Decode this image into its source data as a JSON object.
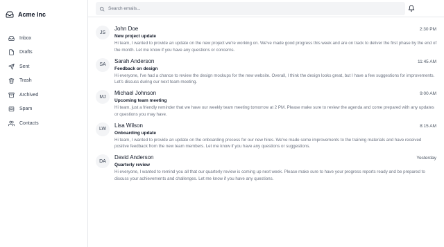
{
  "brand": {
    "name": "Acme Inc",
    "icon": "inbox-tray-icon"
  },
  "sidebar": {
    "items": [
      {
        "label": "Inbox",
        "icon": "inbox-icon"
      },
      {
        "label": "Drafts",
        "icon": "file-icon"
      },
      {
        "label": "Sent",
        "icon": "send-icon"
      },
      {
        "label": "Trash",
        "icon": "trash-icon"
      },
      {
        "label": "Archived",
        "icon": "archive-icon"
      },
      {
        "label": "Spam",
        "icon": "spam-icon"
      },
      {
        "label": "Contacts",
        "icon": "users-icon"
      }
    ]
  },
  "search": {
    "placeholder": "Search emails..."
  },
  "header": {
    "notification_icon": "bell-icon"
  },
  "emails": [
    {
      "initials": "JS",
      "sender": "John Doe",
      "time": "2:30 PM",
      "subject": "New project update",
      "preview": "Hi team, I wanted to provide an update on the new project we're working on. We've made good progress this week and are on track to deliver the first phase by the end of the month. Let me know if you have any questions or concerns."
    },
    {
      "initials": "SA",
      "sender": "Sarah Anderson",
      "time": "11:45 AM",
      "subject": "Feedback on design",
      "preview": "Hi everyone, I've had a chance to review the design mockups for the new website. Overall, I think the design looks great, but I have a few suggestions for improvements. Let's discuss during our next team meeting."
    },
    {
      "initials": "MJ",
      "sender": "Michael Johnson",
      "time": "9:00 AM",
      "subject": "Upcoming team meeting",
      "preview": "Hi team, just a friendly reminder that we have our weekly team meeting tomorrow at 2 PM. Please make sure to review the agenda and come prepared with any updates or questions you may have."
    },
    {
      "initials": "LW",
      "sender": "Lisa Wilson",
      "time": "8:15 AM",
      "subject": "Onboarding update",
      "preview": "Hi team, I wanted to provide an update on the onboarding process for our new hires. We've made some improvements to the training materials and have received positive feedback from the new team members. Let me know if you have any questions or suggestions."
    },
    {
      "initials": "DA",
      "sender": "David Anderson",
      "time": "Yesterday",
      "subject": "Quarterly review",
      "preview": "Hi everyone, I wanted to remind you all that our quarterly review is coming up next week. Please make sure to have your progress reports ready and be prepared to discuss your achievements and challenges. Let me know if you have any questions."
    }
  ]
}
